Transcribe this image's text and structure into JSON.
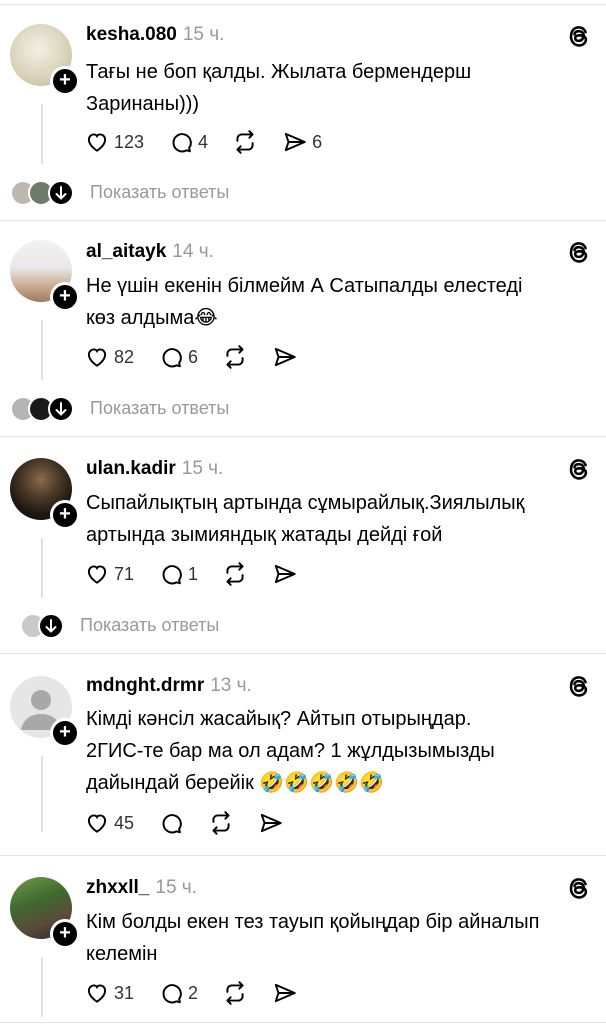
{
  "show_replies_label": "Показать ответы",
  "posts": [
    {
      "username": "kesha.080",
      "time": "15 ч.",
      "lines": [
        "Тағы не боп қалды. Жылата бермендерш",
        "Заринаны)))"
      ],
      "likes": "123",
      "comments": "4",
      "shares": "6"
    },
    {
      "username": "al_aitayk",
      "time": "14 ч.",
      "lines": [
        "Не үшін екенін білмейм А Сатыпалды елестеді",
        "көз алдыма😂"
      ],
      "likes": "82",
      "comments": "6",
      "shares": ""
    },
    {
      "username": "ulan.kadir",
      "time": "15 ч.",
      "lines": [
        "Сыпайлықтың артында сұмырайлық.Зиялылық",
        "артында зымияндық жатады дейді ғой"
      ],
      "likes": "71",
      "comments": "1",
      "shares": ""
    },
    {
      "username": "mdnght.drmr",
      "time": "13 ч.",
      "lines": [
        "Кімді кәнсіл жасайық? Айтып отырыңдар.",
        "2ГИС-те бар ма ол адам? 1 жұлдызымызды",
        "дайындай берейік 🤣🤣🤣🤣🤣"
      ],
      "likes": "45",
      "comments": "",
      "shares": ""
    },
    {
      "username": "zhxxll_",
      "time": "15 ч.",
      "lines": [
        "Кім болды екен тез тауып қойыңдар бір айналып",
        "келемін"
      ],
      "likes": "31",
      "comments": "2",
      "shares": ""
    }
  ]
}
